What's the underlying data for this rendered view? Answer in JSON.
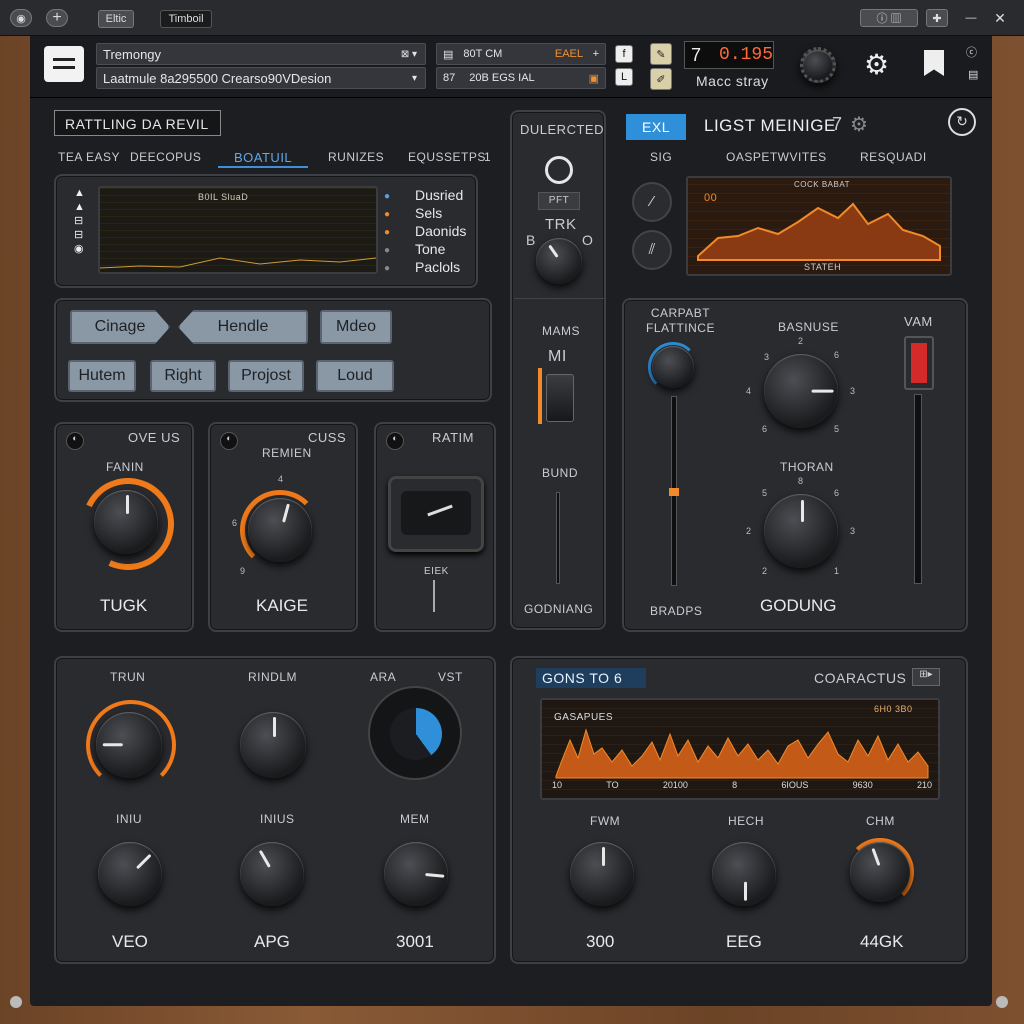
{
  "titlebar": {
    "badge": "Eltic",
    "app_title": "Timboil"
  },
  "topbar": {
    "preset_name": "Tremongy",
    "preset_desc": "Laatmule 8a295500 Crearso90VDesion",
    "field2a": "80T CM",
    "field2a_tag": "EAEL",
    "field2b": "87",
    "field2b_val": "20B EGS IAL",
    "readout_sym": "7",
    "readout_val": "0.195",
    "readout_sub": "Macc stray"
  },
  "left_panel": {
    "title": "RATTLING DA REVIL",
    "tabs": [
      "TEA EASY",
      "DEECOPUS",
      "BOATUIL",
      "RUNIZES",
      "EQUSSETPS"
    ],
    "tab_count": "1",
    "display_title": "B0IL SluaD",
    "legend": [
      "Dusried",
      "Sels",
      "Daonids",
      "Tone",
      "Paclols"
    ]
  },
  "buttons": {
    "b1": "Cinage",
    "b2": "Hendle",
    "b3": "Mdeo",
    "b4": "Hutem",
    "b5": "Right",
    "b6": "Projost",
    "b7": "Loud"
  },
  "knob_panels": [
    {
      "header": "OVE US",
      "sub": "FANIN",
      "name": "TUGK"
    },
    {
      "header": "CUSS",
      "sub": "REMIEN",
      "name": "KAIGE"
    },
    {
      "header": "RATIM",
      "sub": "EIEK",
      "name": ""
    }
  ],
  "center_col": {
    "title": "DULERCTED",
    "tag": "PFT",
    "knob_label": "TRK",
    "left": "B",
    "right": "O",
    "mams": "MAMS",
    "mi": "MI",
    "bund": "BUND",
    "footer": "GODNIANG"
  },
  "right_top": {
    "tab_active": "EXL",
    "title": "LIGST MEINIGE",
    "num": "7",
    "tabs": [
      "SIG",
      "OASPETWVITES",
      "RESQUADI"
    ],
    "screen_title": "COCK BABAT",
    "screen_val": "00",
    "screen_footer": "STATEH"
  },
  "right_mid": {
    "col1": "CARPABT\nFLATTINCE",
    "col1_foot": "BRADPS",
    "knob1": "BASNUSE",
    "knob2": "THORAN",
    "name": "GODUNG",
    "fader": "VAM"
  },
  "bottom_left": {
    "labels": [
      "TRUN",
      "RINDLM",
      "ARA",
      "VST",
      "INIU",
      "INIUS",
      "MEM"
    ],
    "names": [
      "VEO",
      "APG",
      "3001"
    ]
  },
  "bottom_right": {
    "tag": "GONS TO 6",
    "title": "COARACTUS",
    "screen_title": "GASAPUES",
    "screen_val": "6H0 3B0",
    "axis": [
      "10",
      "TO",
      "20100",
      "8",
      "6IOUS",
      "9630",
      "210"
    ],
    "knobs": [
      "FWM",
      "HECH",
      "CHM"
    ],
    "names": [
      "300",
      "EEG",
      "44GK"
    ]
  },
  "colors": {
    "accent": "#f07a1a",
    "blue": "#2f8fd8"
  }
}
